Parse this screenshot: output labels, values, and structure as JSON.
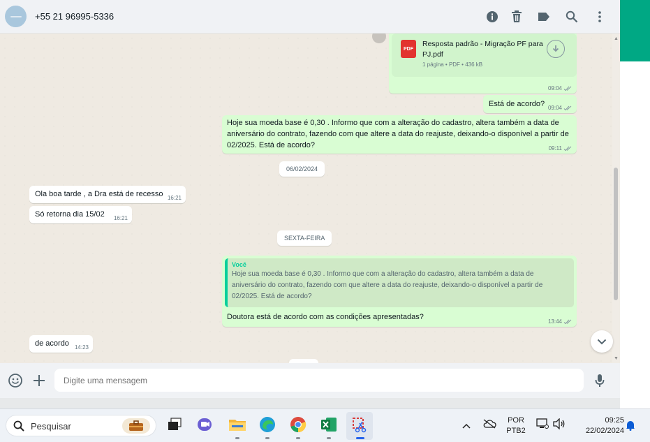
{
  "header": {
    "contact_name": "+55 21 96995-5336"
  },
  "messages": {
    "pdf": {
      "file_name": "Resposta padrão - Migração PF para PJ.pdf",
      "badge": "PDF",
      "meta": "1 página • PDF • 436 kB",
      "time": "09:04"
    },
    "m1": {
      "text": "Está de acordo?",
      "time": "09:04"
    },
    "m2": {
      "text": "Hoje sua moeda base é 0,30 . Informo que com a alteração do cadastro, altera também a data de aniversário do contrato, fazendo com que altere a data do reajuste, deixando-o disponível a partir de 02/2025. Está de acordo?",
      "time": "09:11"
    },
    "date1": "06/02/2024",
    "m3": {
      "text": "Ola boa tarde , a Dra está de recesso",
      "time": "16:21"
    },
    "m4": {
      "text": "Só retorna dia  15/02",
      "time": "16:21"
    },
    "date2": "SEXTA-FEIRA",
    "m5": {
      "quote_author": "Você",
      "quote_text": "Hoje sua moeda base é 0,30 . Informo que com a alteração do cadastro, altera também a data de aniversário do contrato, fazendo com que altere a data do reajuste, deixando-o disponível a partir de 02/2025. Está de acordo?",
      "text": "Doutora está de acordo com as condições apresentadas?",
      "time": "13:44"
    },
    "m6": {
      "text": "de acordo",
      "time": "14:23"
    }
  },
  "composer": {
    "placeholder": "Digite uma mensagem"
  },
  "taskbar": {
    "search_label": "Pesquisar",
    "lang_line1": "POR",
    "lang_line2": "PTB2",
    "clock_time": "09:25",
    "clock_date": "22/02/2024"
  },
  "colors": {
    "accent": "#00a884",
    "outgoing_bubble": "#d9fdd3",
    "incoming_bubble": "#ffffff",
    "quote_bar": "#06cf9c",
    "read_ticks": "#8696a0"
  }
}
